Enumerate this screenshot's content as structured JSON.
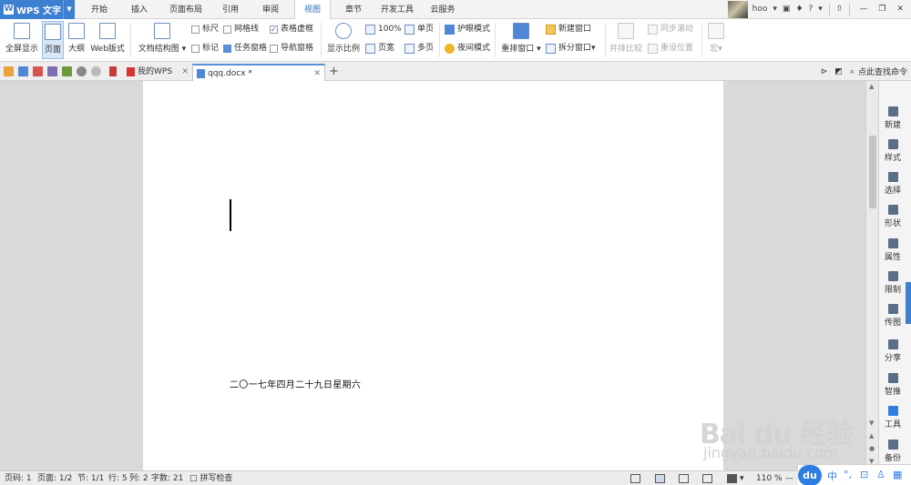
{
  "app": {
    "name": "WPS 文字"
  },
  "menu": {
    "tabs": [
      "开始",
      "插入",
      "页面布局",
      "引用",
      "审阅",
      "视图",
      "章节",
      "开发工具",
      "云服务"
    ],
    "active": "视图",
    "user": "hoo",
    "help": "?"
  },
  "ribbon": {
    "fullscreen": "全屏显示",
    "page": "页面",
    "outline": "大纲",
    "web": "Web版式",
    "doc_map": "文档结构图",
    "ruler": "标尺",
    "gridlines": "网格线",
    "table_frame": "表格虚框",
    "marker": "标记",
    "task_pane": "任务窗格",
    "nav_pane": "导航窗格",
    "zoom_ratio": "显示比例",
    "zoom_100": "100%",
    "page_width": "页宽",
    "single_page": "单页",
    "multi_page": "多页",
    "eye_mode": "护眼模式",
    "night_mode": "夜间模式",
    "rearrange": "重排窗口",
    "new_window": "新建窗口",
    "split_window": "拆分窗口",
    "side_by_side": "并排比较",
    "sync_scroll": "同步滚动",
    "reset_pos": "重设位置",
    "macro": "宏"
  },
  "quickbar": {
    "tabs": [
      {
        "label": "我的WPS"
      },
      {
        "label": "qqq.docx *"
      }
    ],
    "search": "点此查找命令"
  },
  "document": {
    "date_line": "二〇一七年四月二十九日星期六"
  },
  "right_pane": {
    "items": [
      "新建",
      "样式",
      "选择",
      "形状",
      "属性",
      "限制",
      "传图",
      "分享",
      "智推",
      "工具",
      "备份"
    ]
  },
  "status": {
    "page_code": "页码: 1",
    "page": "页面: 1/2",
    "section": "节: 1/1",
    "row": "行: 5",
    "col": "列: 2",
    "words": "字数: 21",
    "spell": "拼写检查",
    "zoom": "110 %"
  },
  "baidu_bar": {
    "logo": "du",
    "lang": "中",
    "punct": "°,"
  },
  "watermark": {
    "main": "Bai du 经验",
    "sub": "jingyan.baidu.com"
  }
}
